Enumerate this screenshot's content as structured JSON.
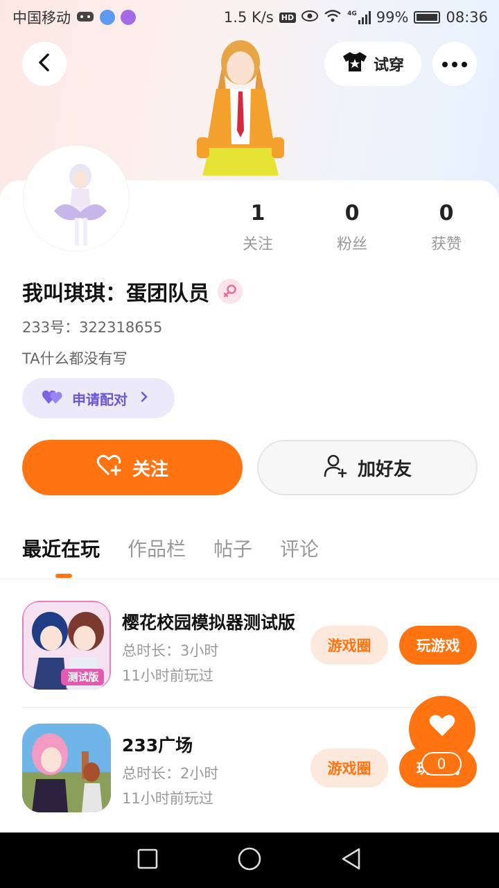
{
  "status_bar": {
    "carrier": "中国移动",
    "net_speed": "1.5 K/s",
    "hd": "HD",
    "network": "4G",
    "battery": "99%",
    "time": "08:36"
  },
  "header": {
    "tryon_label": "试穿"
  },
  "stats": [
    {
      "value": "1",
      "label": "关注"
    },
    {
      "value": "0",
      "label": "粉丝"
    },
    {
      "value": "0",
      "label": "获赞"
    }
  ],
  "profile": {
    "name": "我叫琪琪：蛋团队员",
    "uid": "233号：322318655",
    "bio": "TA什么都没有写",
    "pair_label": "申请配对"
  },
  "actions": {
    "follow_label": "关注",
    "add_friend_label": "加好友"
  },
  "tabs": [
    {
      "label": "最近在玩",
      "active": true
    },
    {
      "label": "作品栏",
      "active": false
    },
    {
      "label": "帖子",
      "active": false
    },
    {
      "label": "评论",
      "active": false
    }
  ],
  "games": [
    {
      "title": "樱花校园模拟器测试版",
      "icon_badge": "测试版",
      "duration": "总时长：3小时",
      "last_played": "11小时前玩过",
      "circle_label": "游戏圈",
      "play_label": "玩游戏"
    },
    {
      "title": "233广场",
      "duration": "总时长：2小时",
      "last_played": "11小时前玩过",
      "circle_label": "游戏圈",
      "play_label": "玩游戏"
    }
  ],
  "floating_like": {
    "count": "0"
  },
  "colors": {
    "accent": "#ff7410",
    "pair_bg": "#ece9fb",
    "pair_text": "#6b55d8"
  }
}
